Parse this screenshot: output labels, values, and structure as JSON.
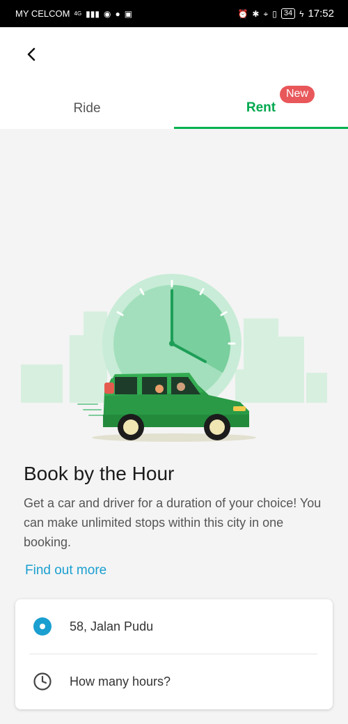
{
  "status_bar": {
    "carrier": "MY CELCOM",
    "network": "4G",
    "battery": "34",
    "time": "17:52"
  },
  "header": {
    "back_icon": "chevron-left-icon",
    "tabs": [
      {
        "label": "Ride",
        "active": false
      },
      {
        "label": "Rent",
        "active": true,
        "badge": "New"
      }
    ],
    "accent_color": "#00b14f",
    "badge_color": "#e8575a"
  },
  "main": {
    "title": "Book by the Hour",
    "description": "Get a car and driver for a duration of your choice! You can make unlimited stops within this city in one booking.",
    "link": "Find out more",
    "link_color": "#1a9fd0"
  },
  "booking": {
    "pickup": "58, Jalan Pudu",
    "hours_placeholder": "How many hours?"
  }
}
